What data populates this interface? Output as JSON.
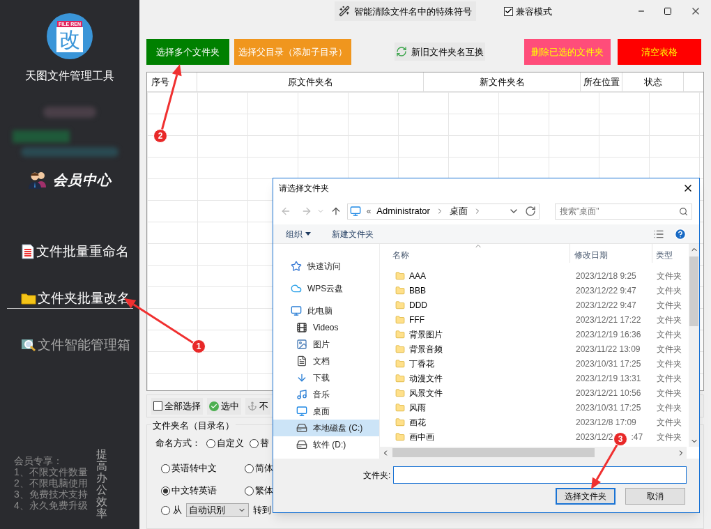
{
  "sidebar": {
    "logo": {
      "banner": "FILE REN",
      "glyph": "改"
    },
    "app_name": "天图文件管理工具",
    "member_center": "会员中心",
    "items": [
      {
        "label": "文件批量重命名",
        "selected": false,
        "disabled": false
      },
      {
        "label": "文件夹批量改名",
        "selected": true,
        "disabled": false
      },
      {
        "label": "文件智能管理箱",
        "selected": false,
        "disabled": true
      }
    ],
    "perks": [
      "会员专享：",
      "1、不限文件数量",
      "2、不限电脑使用",
      "3、免费技术支持",
      "4、永久免费升级"
    ],
    "slogan": "提高办公效率"
  },
  "topbar": {
    "clean_button": "智能清除文件名中的特殊符号",
    "compat": {
      "label": "兼容模式",
      "checked": true
    }
  },
  "actions": [
    {
      "label": "选择多个文件夹",
      "color": "#008000"
    },
    {
      "label": "选择父目录（添加子目录）",
      "color": "#f0961e"
    },
    {
      "label": "新旧文件夹名互换",
      "color": "#e8e8e8"
    },
    {
      "label": "删除已选的文件夹",
      "color": "#ff4d7a"
    },
    {
      "label": "清空表格",
      "color": "#ff0000"
    }
  ],
  "table": {
    "columns": [
      "序号",
      "原文件夹名",
      "新文件夹名",
      "所在位置",
      "状态"
    ]
  },
  "select_bar": [
    {
      "kind": "checkbox",
      "label": "全部选择",
      "checked": false
    },
    {
      "kind": "check",
      "label": "选中"
    },
    {
      "kind": "anchor",
      "label": "不"
    }
  ],
  "naming": {
    "title": "文件夹名（目录名）",
    "mode_label": "命名方式：",
    "options": [
      {
        "label": "自定义",
        "selected": false
      },
      {
        "label": "替",
        "selected": false
      },
      {
        "label": "英语转中文",
        "selected": false
      },
      {
        "label": "简体",
        "selected": false
      },
      {
        "label": "中文转英语",
        "selected": true
      },
      {
        "label": "繁体",
        "selected": false
      }
    ],
    "from": {
      "label": "从",
      "selected": false,
      "value": "自动识别",
      "to_label": "转到"
    }
  },
  "dialog": {
    "title": "请选择文件夹",
    "path_prefix": "«",
    "path": [
      "Administrator",
      "桌面"
    ],
    "search": {
      "placeholder": "搜索\"桌面\""
    },
    "toolbar": {
      "organize": "组织",
      "new_folder": "新建文件夹"
    },
    "nav": [
      {
        "label": "快速访问",
        "selected": false
      },
      {
        "label": "WPS云盘",
        "selected": false
      },
      {
        "label": "此电脑",
        "selected": false,
        "children": [
          {
            "label": "Videos",
            "selected": false
          },
          {
            "label": "图片",
            "selected": false
          },
          {
            "label": "文档",
            "selected": false
          },
          {
            "label": "下载",
            "selected": false
          },
          {
            "label": "音乐",
            "selected": false
          },
          {
            "label": "桌面",
            "selected": false
          },
          {
            "label": "本地磁盘 (C:)",
            "selected": true
          },
          {
            "label": "软件 (D:)",
            "selected": false
          }
        ]
      }
    ],
    "columns": [
      "名称",
      "修改日期",
      "类型"
    ],
    "files": [
      {
        "name": "AAA",
        "date": "2023/12/18 9:25",
        "type": "文件夹"
      },
      {
        "name": "BBB",
        "date": "2023/12/22 9:47",
        "type": "文件夹"
      },
      {
        "name": "DDD",
        "date": "2023/12/22 9:47",
        "type": "文件夹"
      },
      {
        "name": "FFF",
        "date": "2023/12/21 17:22",
        "type": "文件夹"
      },
      {
        "name": "背景图片",
        "date": "2023/12/19 16:36",
        "type": "文件夹"
      },
      {
        "name": "背景音频",
        "date": "2023/11/22 13:09",
        "type": "文件夹"
      },
      {
        "name": "丁香花",
        "date": "2023/10/31 17:25",
        "type": "文件夹"
      },
      {
        "name": "动漫文件",
        "date": "2023/12/19 13:31",
        "type": "文件夹"
      },
      {
        "name": "风景文件",
        "date": "2023/12/21 10:56",
        "type": "文件夹"
      },
      {
        "name": "风雨",
        "date": "2023/10/31 17:25",
        "type": "文件夹"
      },
      {
        "name": "画花",
        "date": "2023/12/8 17:09",
        "type": "文件夹"
      },
      {
        "name": "画中画",
        "date": "2023/12/2",
        "date_tail": ":47",
        "type": "文件夹"
      }
    ],
    "folder_label": "文件夹:",
    "buttons": [
      "选择文件夹",
      "取消"
    ]
  },
  "annotations": [
    "1",
    "2",
    "3"
  ]
}
